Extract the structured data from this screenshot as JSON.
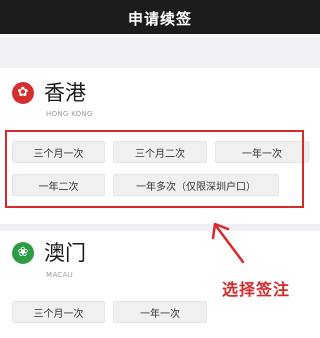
{
  "header": {
    "title": "申请续签"
  },
  "sections": {
    "hk": {
      "name": "香港",
      "english": "HONG KONG",
      "emblem_icon": "bauhinia-flower-icon",
      "emblem_color": "#d32f2f",
      "options": [
        "三个月一次",
        "三个月二次",
        "一年一次",
        "一年二次",
        "一年多次（仅限深圳户口）"
      ]
    },
    "mo": {
      "name": "澳门",
      "english": "MACAU",
      "emblem_icon": "lotus-flower-icon",
      "emblem_color": "#2e9b45",
      "options": [
        "三个月一次",
        "一年一次"
      ]
    }
  },
  "annotation": {
    "text": "选择签注",
    "color": "#d42a2a"
  }
}
